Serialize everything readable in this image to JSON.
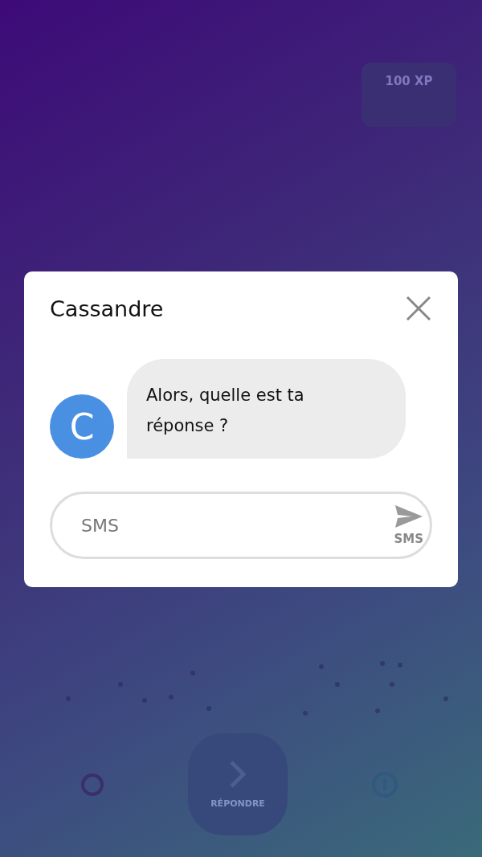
{
  "background": {
    "xp_badge": "100 XP",
    "answer_button": "RÉPONDRE"
  },
  "dialog": {
    "title": "Cassandre",
    "messages": [
      {
        "avatar_letter": "C",
        "color": "#4a90e2",
        "text": "Alors, quelle est ta réponse ?"
      }
    ],
    "input": {
      "placeholder": "SMS",
      "send_label": "SMS"
    }
  }
}
